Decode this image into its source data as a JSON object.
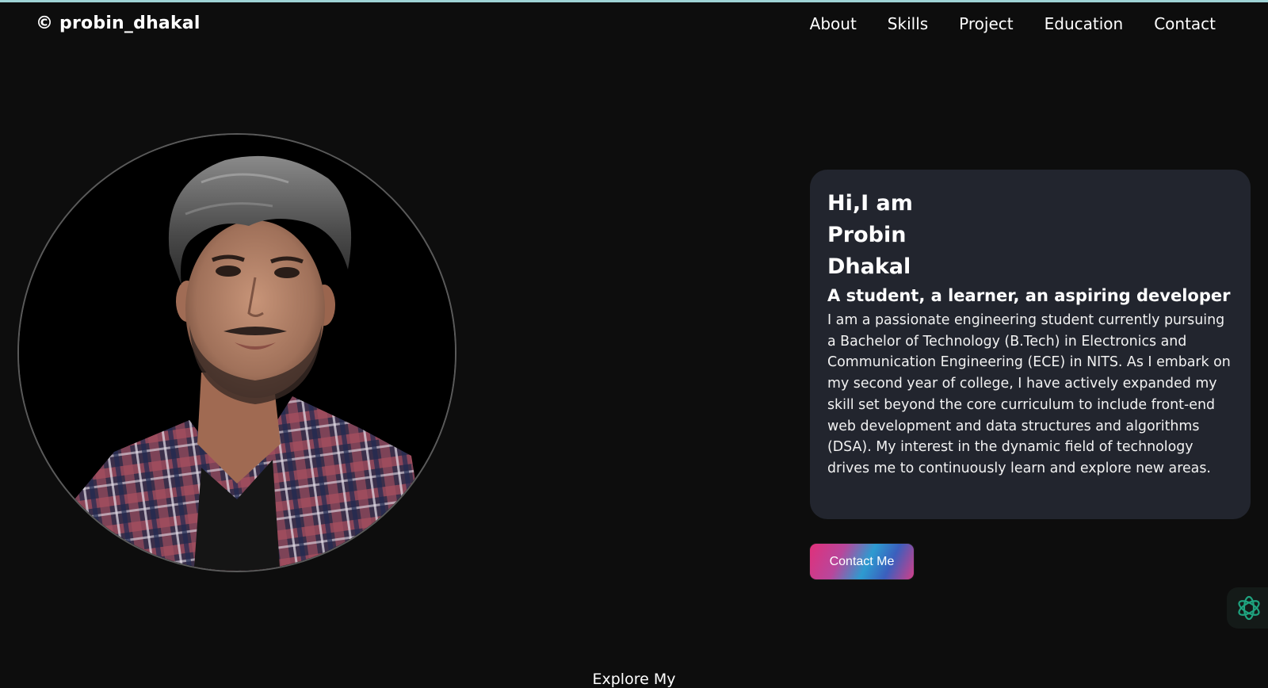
{
  "header": {
    "brand": "© probin_dhakal",
    "nav": [
      "About",
      "Skills",
      "Project",
      "Education",
      "Contact"
    ]
  },
  "hero": {
    "greeting": "Hi,I am Probin Dhakal",
    "tagline": "A student, a learner, an aspiring developer",
    "bio": "I am a passionate engineering student currently pursuing a Bachelor of Technology (B.Tech) in Electronics and Communication Engineering (ECE) in NITS. As I embark on my second year of college, I have actively expanded my skill set beyond the core curriculum to include front-end web development and data structures and algorithms (DSA). My interest in the dynamic field of technology drives me to continuously learn and explore new areas.",
    "cta_label": "Contact Me"
  },
  "explore": {
    "label": "Explore My"
  },
  "icons": {
    "assistant": "openai-logo-icon"
  },
  "colors": {
    "background": "#0d0d0d",
    "card": "#22252e",
    "accent_pink": "#e0307a",
    "accent_blue": "#2d9bd0",
    "assistant_green": "#1fa37f"
  }
}
